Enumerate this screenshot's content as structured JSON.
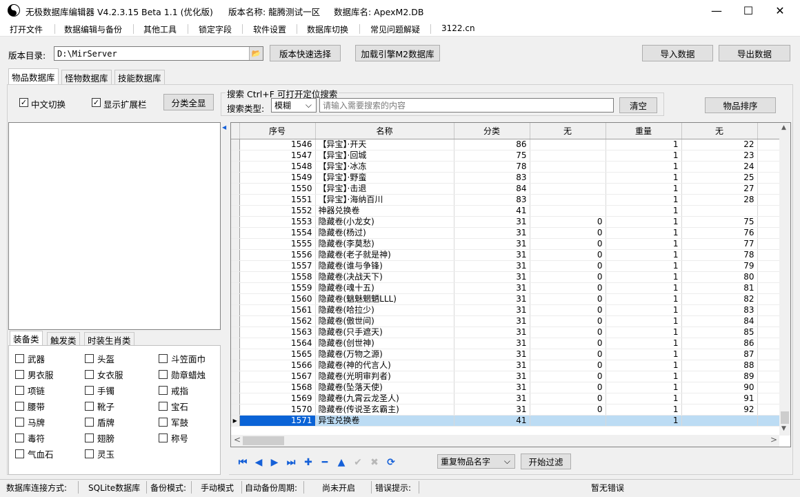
{
  "window": {
    "title": "无极数据库编辑器 V4.2.3.15",
    "beta": "Beta 1.1 (优化版)",
    "version_name": "版本名称: 龍腾测试一区",
    "db_name": "数据库名: ApexM2.DB",
    "minimize": "—",
    "maximize": "☐",
    "close": "✕"
  },
  "menu": [
    "打开文件",
    "数据编辑与备份",
    "其他工具",
    "锁定字段",
    "软件设置",
    "数据库切换",
    "常见问题解疑",
    "3122.cn"
  ],
  "toolbar": {
    "dir_label": "版本目录:",
    "dir_value": "D:\\MirServer",
    "folder_icon": "📂",
    "quick_select": "版本快速选择",
    "load_engine": "加载引擎M2数据库",
    "import": "导入数据",
    "export": "导出数据"
  },
  "tabs": [
    "物品数据库",
    "怪物数据库",
    "技能数据库"
  ],
  "filters": {
    "chinese_switch": "中文切换",
    "show_ext": "显示扩展栏",
    "show_all": "分类全显",
    "check": "✓",
    "search_group": "搜索  Ctrl+F 可打开定位搜索",
    "search_type_label": "搜索类型:",
    "search_type_value": "模糊",
    "dropdown": "⌵",
    "search_placeholder": "请输入需要搜索的内容",
    "clear": "清空",
    "sort": "物品排序"
  },
  "category_tabs": [
    "装备类",
    "触发类",
    "时装生肖类"
  ],
  "categories": [
    "武器",
    "头盔",
    "斗笠面巾",
    "男衣服",
    "女衣服",
    "勋章蜡烛",
    "项链",
    "手镯",
    "戒指",
    "腰带",
    "靴子",
    "宝石",
    "马牌",
    "盾牌",
    "军鼓",
    "毒符",
    "翅膀",
    "称号",
    "气血石",
    "灵玉"
  ],
  "grid": {
    "headers": [
      "序号",
      "名称",
      "分类",
      "无",
      "重量",
      "无"
    ],
    "row_marker": "▶",
    "rows": [
      [
        "1546",
        "【异宝】·开天",
        "86",
        "",
        "1",
        "22"
      ],
      [
        "1547",
        "【异宝】·回城",
        "75",
        "",
        "1",
        "23"
      ],
      [
        "1548",
        "【异宝】·冰冻",
        "78",
        "",
        "1",
        "24"
      ],
      [
        "1549",
        "【异宝】·野蛮",
        "83",
        "",
        "1",
        "25"
      ],
      [
        "1550",
        "【异宝】·击退",
        "84",
        "",
        "1",
        "27"
      ],
      [
        "1551",
        "【异宝】·海纳百川",
        "83",
        "",
        "1",
        "28"
      ],
      [
        "1552",
        "神器兑换卷",
        "41",
        "",
        "1",
        ""
      ],
      [
        "1553",
        "隐藏卷(小龙女)",
        "31",
        "0",
        "1",
        "75"
      ],
      [
        "1554",
        "隐藏卷(杨过)",
        "31",
        "0",
        "1",
        "76"
      ],
      [
        "1555",
        "隐藏卷(李莫愁)",
        "31",
        "0",
        "1",
        "77"
      ],
      [
        "1556",
        "隐藏卷(老子就是神)",
        "31",
        "0",
        "1",
        "78"
      ],
      [
        "1557",
        "隐藏卷(谁与争锋)",
        "31",
        "0",
        "1",
        "79"
      ],
      [
        "1558",
        "隐藏卷(决战天下)",
        "31",
        "0",
        "1",
        "80"
      ],
      [
        "1559",
        "隐藏卷(魂十五)",
        "31",
        "0",
        "1",
        "81"
      ],
      [
        "1560",
        "隐藏卷(魑魅魍魉LLL)",
        "31",
        "0",
        "1",
        "82"
      ],
      [
        "1561",
        "隐藏卷(哈拉少)",
        "31",
        "0",
        "1",
        "83"
      ],
      [
        "1562",
        "隐藏卷(傲世间)",
        "31",
        "0",
        "1",
        "84"
      ],
      [
        "1563",
        "隐藏卷(只手遮天)",
        "31",
        "0",
        "1",
        "85"
      ],
      [
        "1564",
        "隐藏卷(创世神)",
        "31",
        "0",
        "1",
        "86"
      ],
      [
        "1565",
        "隐藏卷(万物之源)",
        "31",
        "0",
        "1",
        "87"
      ],
      [
        "1566",
        "隐藏卷(神的代言人)",
        "31",
        "0",
        "1",
        "88"
      ],
      [
        "1567",
        "隐藏卷(光明审判者)",
        "31",
        "0",
        "1",
        "89"
      ],
      [
        "1568",
        "隐藏卷(坠落天使)",
        "31",
        "0",
        "1",
        "90"
      ],
      [
        "1569",
        "隐藏卷(九霄云龙圣人)",
        "31",
        "0",
        "1",
        "91"
      ],
      [
        "1570",
        "隐藏卷(传说圣玄霸主)",
        "31",
        "0",
        "1",
        "92"
      ],
      [
        "1571",
        "异宝兑换卷",
        "41",
        "",
        "1",
        ""
      ]
    ],
    "selected_index": 25
  },
  "scroll": {
    "up": "▲",
    "down": "▼",
    "left": "<",
    "right": ">",
    "collapse": "◀"
  },
  "nav": {
    "first": "⏮",
    "prev": "◀",
    "next": "▶",
    "last": "⏭",
    "add": "✚",
    "remove": "━",
    "up": "▲",
    "confirm": "✔",
    "cancel": "✖",
    "refresh": "⟳",
    "filter_value": "重复物品名字",
    "start_filter": "开始过滤"
  },
  "status": {
    "conn_label": "数据库连接方式:",
    "conn_value": "SQLite数据库",
    "backup_label": "备份模式:",
    "backup_value": "手动模式",
    "auto_label": "自动备份周期:",
    "auto_value": "尚未开启",
    "error_label": "错误提示:",
    "error_value": "暂无错误"
  }
}
